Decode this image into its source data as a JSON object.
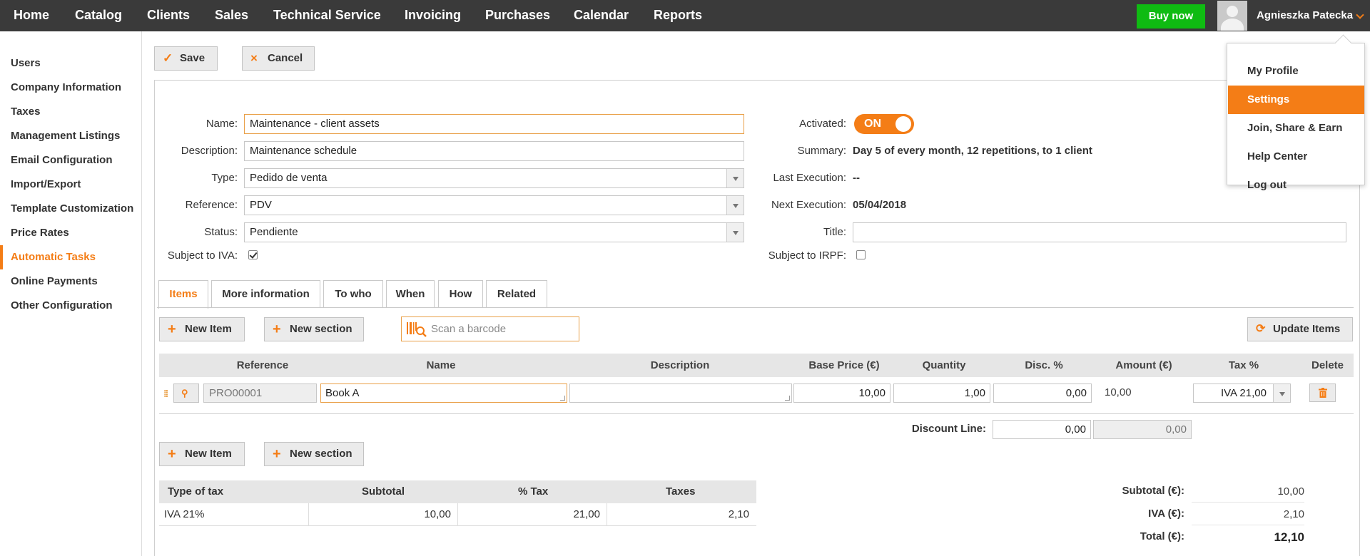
{
  "nav": {
    "items": [
      "Home",
      "Catalog",
      "Clients",
      "Sales",
      "Technical Service",
      "Invoicing",
      "Purchases",
      "Calendar",
      "Reports"
    ],
    "buy_now": "Buy now",
    "user_name": "Agnieszka Patecka"
  },
  "user_menu": {
    "items": [
      "My Profile",
      "Settings",
      "Join, Share & Earn",
      "Help Center",
      "Log out"
    ],
    "active": "Settings"
  },
  "sidebar": {
    "items": [
      "Users",
      "Company Information",
      "Taxes",
      "Management Listings",
      "Email Configuration",
      "Import/Export",
      "Template Customization",
      "Price Rates",
      "Automatic Tasks",
      "Online Payments",
      "Other Configuration"
    ],
    "active": "Automatic Tasks"
  },
  "toolbar": {
    "save": "Save",
    "cancel": "Cancel"
  },
  "form": {
    "name_label": "Name:",
    "name_value": "Maintenance - client assets",
    "description_label": "Description:",
    "description_value": "Maintenance schedule",
    "type_label": "Type:",
    "type_value": "Pedido de venta",
    "reference_label": "Reference:",
    "reference_value": "PDV",
    "status_label": "Status:",
    "status_value": "Pendiente",
    "iva_label": "Subject to IVA:",
    "iva_checked": true,
    "activated_label": "Activated:",
    "activated_value": "ON",
    "summary_label": "Summary:",
    "summary_value": "Day 5 of every month, 12 repetitions, to 1 client",
    "last_exec_label": "Last Execution:",
    "last_exec_value": "--",
    "next_exec_label": "Next Execution:",
    "next_exec_value": "05/04/2018",
    "title_label": "Title:",
    "title_value": "",
    "irpf_label": "Subject to IRPF:",
    "irpf_checked": false
  },
  "tabs": [
    "Items",
    "More information",
    "To who",
    "When",
    "How",
    "Related"
  ],
  "items": {
    "new_item": "New Item",
    "new_section": "New section",
    "scan_placeholder": "Scan a barcode",
    "update_items": "Update Items",
    "headers": [
      "Reference",
      "Name",
      "Description",
      "Base Price (€)",
      "Quantity",
      "Disc. %",
      "Amount (€)",
      "Tax %",
      "Delete"
    ],
    "rows": [
      {
        "reference": "PRO00001",
        "name": "Book A",
        "description": "",
        "base_price": "10,00",
        "quantity": "1,00",
        "discount": "0,00",
        "amount": "10,00",
        "tax": "IVA 21,00"
      }
    ],
    "discount_line_label": "Discount Line:",
    "discount_line_value": "0,00",
    "discount_line_amount": "0,00"
  },
  "tax_table": {
    "headers": [
      "Type of tax",
      "Subtotal",
      "% Tax",
      "Taxes"
    ],
    "rows": [
      {
        "type": "IVA 21%",
        "subtotal": "10,00",
        "pct": "21,00",
        "taxes": "2,10"
      }
    ]
  },
  "totals": {
    "subtotal_label": "Subtotal (€):",
    "subtotal": "10,00",
    "iva_label": "IVA (€):",
    "iva": "2,10",
    "total_label": "Total (€):",
    "total": "12,10"
  },
  "colors": {
    "accent": "#f47d16",
    "buy": "#0fbb12",
    "nav_bg": "#3a3a3a"
  },
  "icons": [
    "checkmark-icon",
    "close-icon",
    "plus-icon",
    "barcode-search-icon",
    "refresh-icon",
    "drag-handle-icon",
    "magnifier-icon",
    "trash-icon",
    "chevron-down-icon",
    "user-avatar-icon"
  ]
}
